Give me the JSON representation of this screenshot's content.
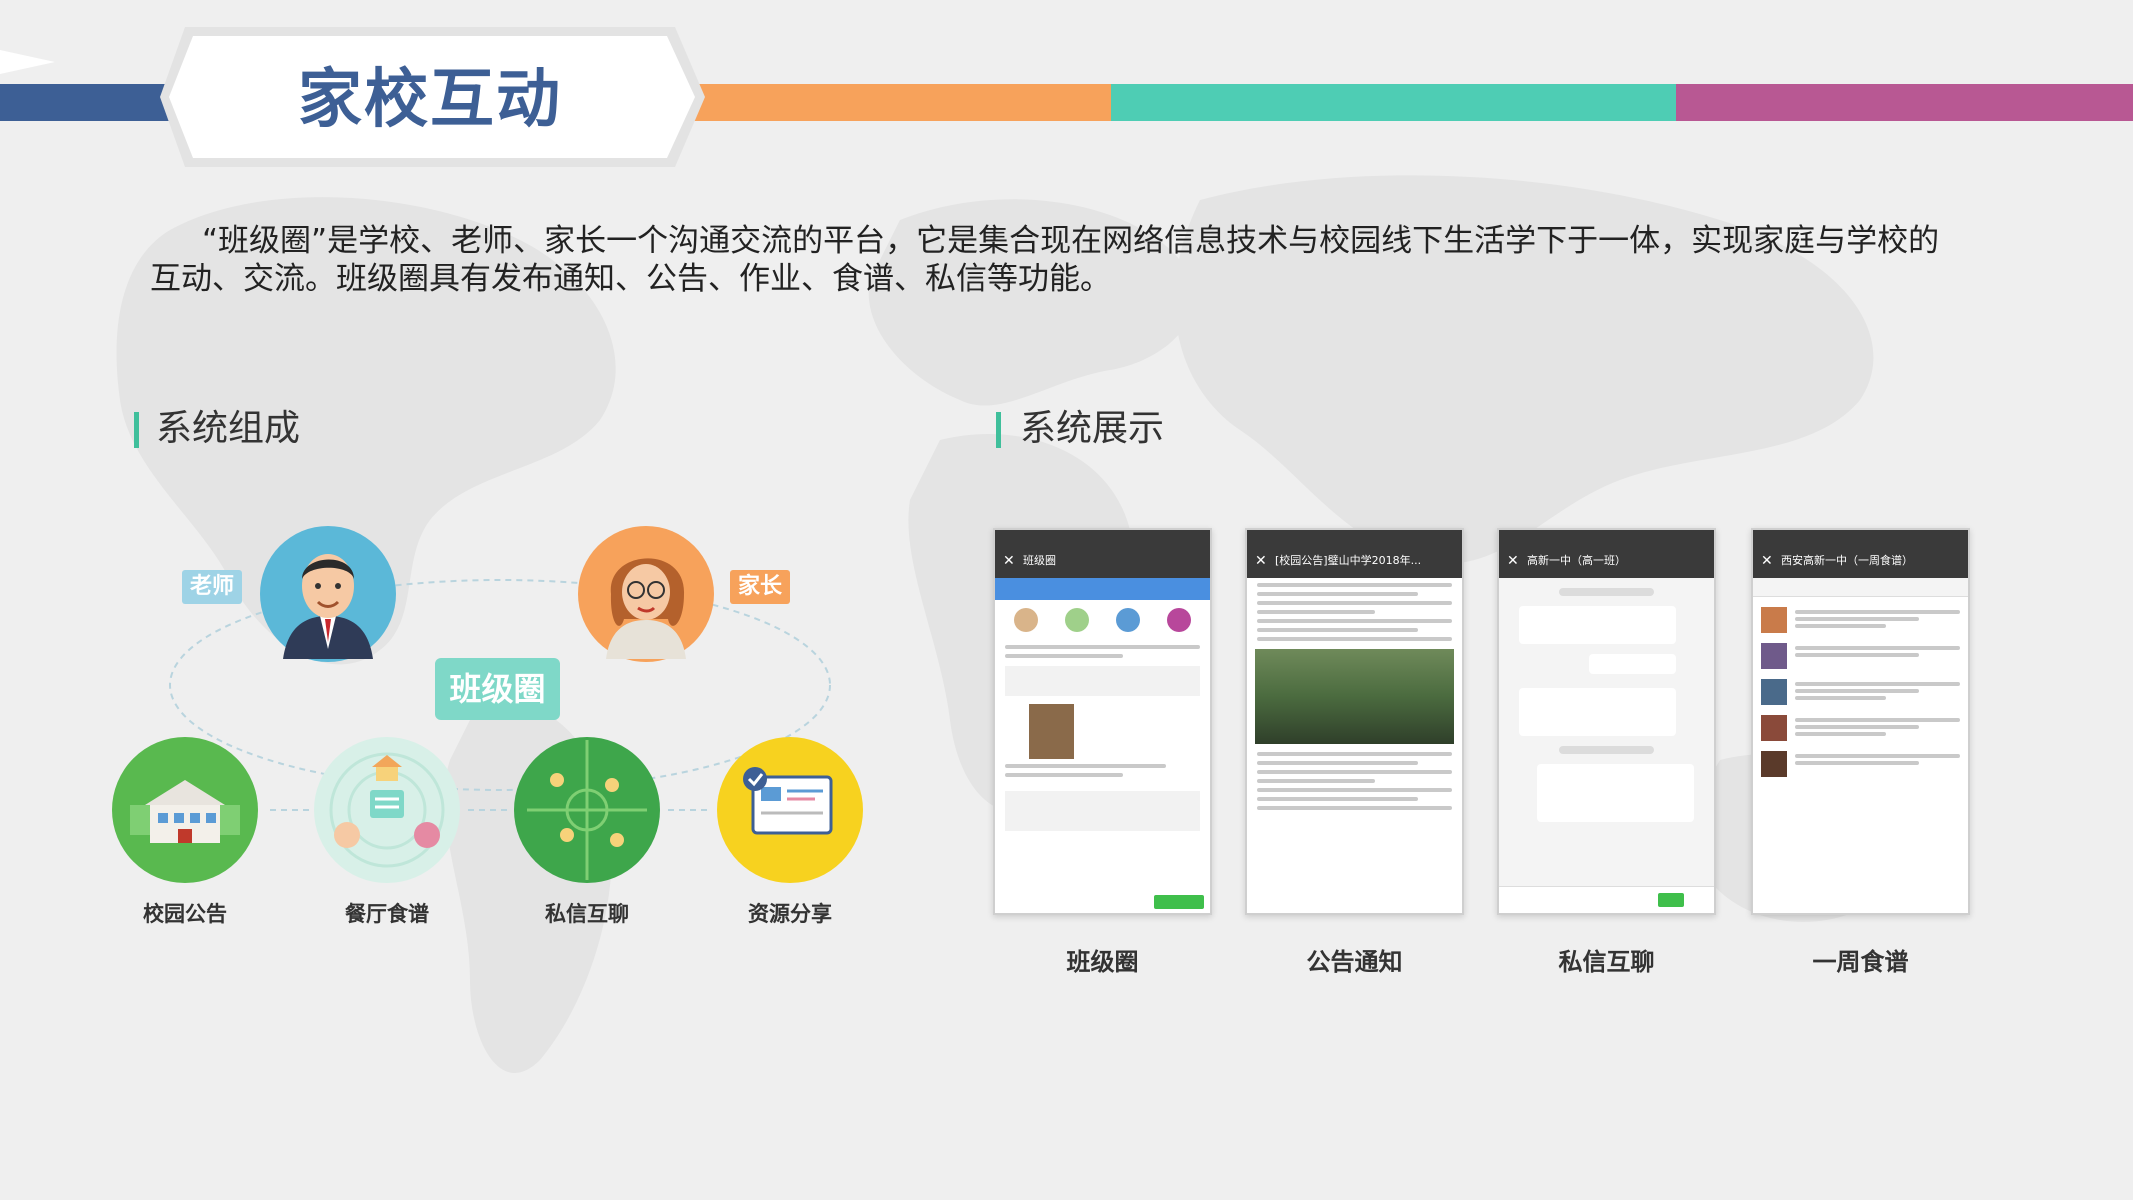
{
  "header": {
    "title": "家校互动"
  },
  "intro": {
    "text": "“班级圈”是学校、老师、家长一个沟通交流的平台，它是集合现在网络信息技术与校园线下生活学下于一体，实现家庭与学校的互动、交流。班级圈具有发布通知、公告、作业、食谱、私信等功能。"
  },
  "composition": {
    "title": "系统组成",
    "center_label": "班级圈",
    "roles": {
      "teacher": "老师",
      "parent": "家长"
    },
    "nodes": [
      "校园公告",
      "餐厅食谱",
      "私信互聊",
      "资源分享"
    ]
  },
  "showcase": {
    "title": "系统展示",
    "screens": [
      {
        "caption": "班级圈",
        "header": "班级圈"
      },
      {
        "caption": "公告通知",
        "header": "[校园公告]璧山中学2018年..."
      },
      {
        "caption": "私信互聊",
        "header": "高新一中（高一班）"
      },
      {
        "caption": "一周食谱",
        "header": "西安高新一中（一周食谱）"
      }
    ]
  },
  "colors": {
    "stripe_blue": "#3d5f95",
    "stripe_orange": "#f7a25b",
    "stripe_teal": "#4ecdb4",
    "stripe_purple": "#b85893",
    "title": "#3d5f95",
    "accent": "#3fbf9b"
  },
  "icons": [
    "teacher-avatar-icon",
    "parent-avatar-icon",
    "school-building-icon",
    "menu-icon",
    "chat-field-icon",
    "resource-share-icon"
  ]
}
